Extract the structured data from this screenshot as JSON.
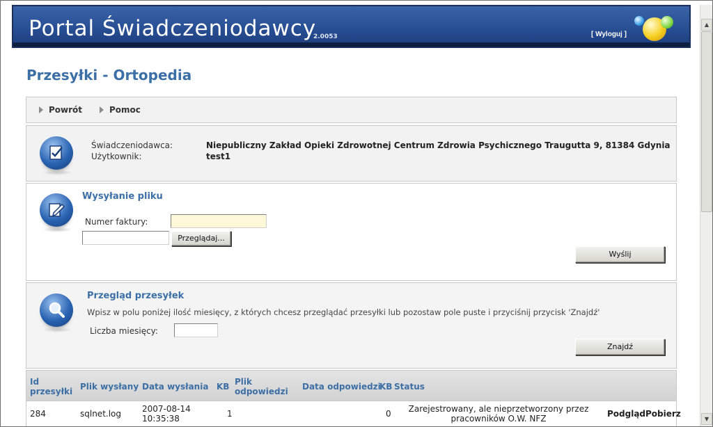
{
  "header": {
    "title": "Portal Świadczeniodawcy",
    "version": "2.0053",
    "logout_label": "[ Wyloguj ]"
  },
  "page": {
    "title": "Przesyłki - Ortopedia"
  },
  "nav": {
    "items": [
      {
        "label": "Powrót"
      },
      {
        "label": "Pomoc"
      }
    ]
  },
  "info": {
    "provider_label": "Świadczeniodawca:",
    "provider_value": "Niepubliczny Zakład Opieki Zdrowotnej Centrum Zdrowia Psychicznego Traugutta 9, 81384 Gdynia",
    "user_label": "Użytkownik:",
    "user_value": "test1"
  },
  "upload": {
    "title": "Wysyłanie pliku",
    "invoice_label": "Numer faktury:",
    "invoice_value": "",
    "file_value": "",
    "browse_label": "Przeglądaj...",
    "send_label": "Wyślij"
  },
  "search": {
    "title": "Przegląd przesyłek",
    "hint": "Wpisz w polu poniżej ilość miesięcy, z których chcesz przeglądać przesyłki lub pozostaw pole puste i przyciśnij przycisk 'Znajdź'",
    "months_label": "Liczba miesięcy:",
    "months_value": "",
    "find_label": "Znajdź"
  },
  "table": {
    "headers": {
      "id_line1": "Id",
      "id_line2": "przesyłki",
      "sent_file": "Plik wysłany",
      "sent_date": "Data wysłania",
      "kb1": "KB",
      "resp_file_line1": "Plik",
      "resp_file_line2": "odpowiedzi",
      "resp_date": "Data odpowiedzi",
      "kb2": "KB",
      "status": "Status"
    },
    "rows": [
      {
        "id": "284",
        "sent_file": "sqlnet.log",
        "sent_date_line1": "2007-08-14",
        "sent_date_line2": "10:35:38",
        "kb1": "1",
        "resp_file": "",
        "resp_date": "",
        "kb2": "0",
        "status_line1": "Zarejestrowany, ale nieprzetworzony przez",
        "status_line2": "pracowników O.W. NFZ",
        "preview_label": "Podgląd",
        "download_label": "Pobierz"
      }
    ]
  },
  "colors": {
    "header_blue": "#284f94",
    "title_blue": "#3c6fa6",
    "panel_grey": "#f2f2f2",
    "input_yellow": "#fff8d8"
  },
  "icons": [
    "checklist-icon",
    "edit-document-icon",
    "magnifier-icon",
    "balls-logo"
  ]
}
